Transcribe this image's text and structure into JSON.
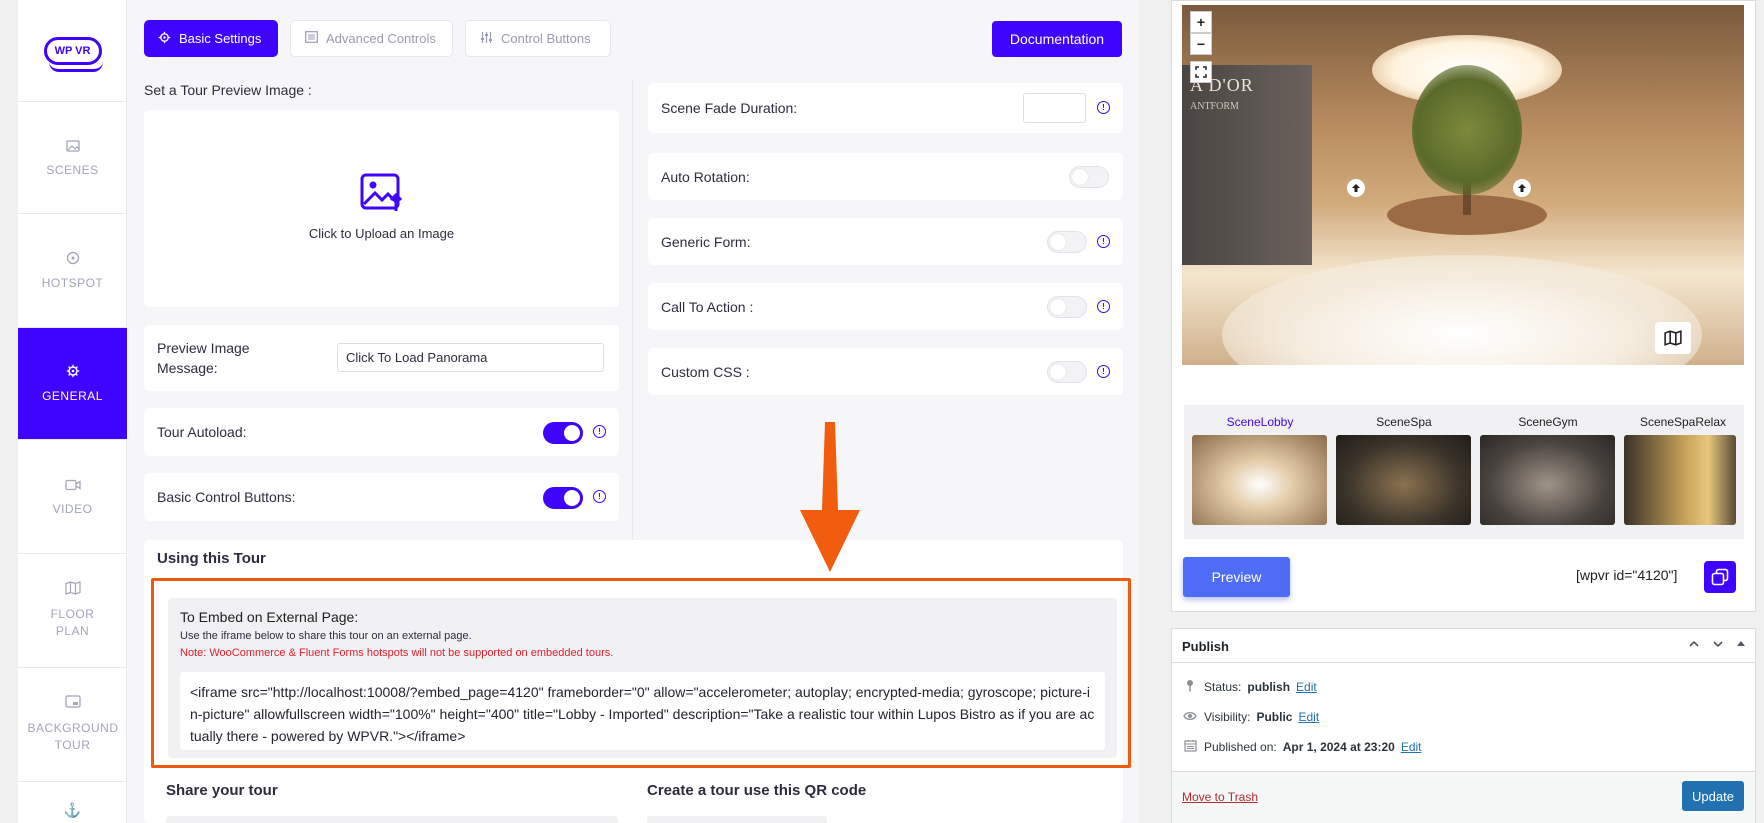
{
  "logo": {
    "text": "WP VR"
  },
  "sidebar": {
    "items": [
      {
        "label": "SCENES",
        "icon": "image-icon"
      },
      {
        "label": "HOTSPOT",
        "icon": "target-icon"
      },
      {
        "label": "GENERAL",
        "icon": "gear-icon"
      },
      {
        "label": "VIDEO",
        "icon": "video-icon"
      },
      {
        "label": "FLOOR PLAN",
        "icon": "map-icon"
      },
      {
        "label": "BACKGROUND TOUR",
        "icon": "background-icon"
      }
    ]
  },
  "tabs": {
    "basic": "Basic Settings",
    "advanced": "Advanced Controls",
    "control": "Control Buttons"
  },
  "documentation": "Documentation",
  "left_panel": {
    "preview_title": "Set a Tour Preview Image :",
    "upload_text": "Click to Upload an Image",
    "preview_message_label": "Preview Image Message:",
    "preview_message_value": "Click To Load Panorama",
    "autoload_label": "Tour Autoload:",
    "basic_controls_label": "Basic Control Buttons:"
  },
  "right_panel": {
    "fade_label": "Scene Fade Duration:",
    "fade_value": "",
    "auto_rotation_label": "Auto Rotation:",
    "generic_form_label": "Generic Form:",
    "cta_label": "Call To Action :",
    "custom_css_label": "Custom CSS :"
  },
  "using_tour": {
    "title": "Using this Tour",
    "embed_title": "To Embed on External Page:",
    "embed_desc": "Use the iframe below to share this tour on an external page.",
    "embed_note": "Note: WooCommerce & Fluent Forms hotspots will not be supported on embedded tours.",
    "embed_code": "<iframe src=\"http://localhost:10008/?embed_page=4120\" frameborder=\"0\" allow=\"accelerometer; autoplay; encrypted-media; gyroscope; picture-in-picture\" allowfullscreen width=\"100%\" height=\"400\" title=\"Lobby - Imported\" description=\"Take a realistic tour within Lupos Bistro as if you are actually there - powered by WPVR.\"></iframe>",
    "share_title": "Share your tour",
    "qr_title": "Create a tour use this QR code"
  },
  "pano": {
    "zoom_in": "+",
    "zoom_out": "−",
    "wall_text": "A D'OR",
    "wall_sub": "ANTFORM"
  },
  "scenes": [
    {
      "name": "SceneLobby",
      "active": true,
      "color": "#c8a47c"
    },
    {
      "name": "SceneSpa",
      "active": false,
      "color": "#3b342a"
    },
    {
      "name": "SceneGym",
      "active": false,
      "color": "#4a4440"
    },
    {
      "name": "SceneSpaRelax",
      "active": false,
      "color": "#6a5a3d"
    }
  ],
  "preview_btn": "Preview",
  "shortcode": "[wpvr id=\"4120\"]",
  "publish": {
    "title": "Publish",
    "status_label": "Status:",
    "status_value": "publish",
    "visibility_label": "Visibility:",
    "visibility_value": "Public",
    "published_label": "Published on:",
    "published_value": "Apr 1, 2024 at 23:20",
    "edit": "Edit",
    "trash": "Move to Trash",
    "update": "Update"
  },
  "colors": {
    "accent": "#3f04fe",
    "highlight": "#ef5a0e",
    "note": "#e0202e"
  }
}
